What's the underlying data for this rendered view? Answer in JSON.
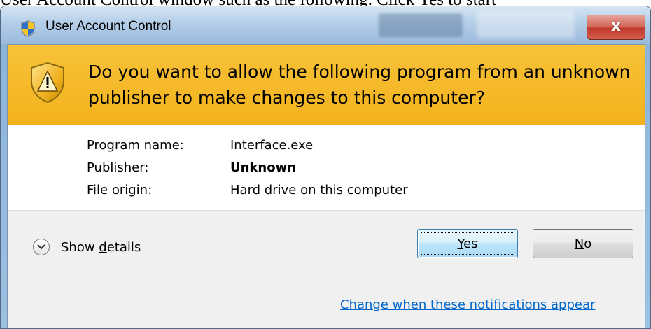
{
  "background_doc": {
    "text": "User Account Control window such as the following. Click Yes to start"
  },
  "dialog": {
    "title": "User Account Control",
    "close_glyph": "x",
    "title_icon": "uac-shield-icon",
    "headline": "Do you want to allow the following program from an unknown publisher to make changes to this computer?",
    "warning_icon": "warning-shield-icon",
    "banner_color": "#f3b21c",
    "details": [
      {
        "label": "Program name:",
        "value": "Interface.exe",
        "bold": false
      },
      {
        "label": "Publisher:",
        "value": "Unknown",
        "bold": true
      },
      {
        "label": "File origin:",
        "value": "Hard drive on this computer",
        "bold": false
      }
    ],
    "show_details": {
      "prefix": "Show ",
      "accel": "d",
      "suffix": "etails"
    },
    "yes_button": {
      "accel": "Y",
      "rest": "es"
    },
    "no_button": {
      "accel": "N",
      "rest": "o"
    },
    "change_link": "Change when these notifications appear",
    "link_color": "#0066cc"
  }
}
